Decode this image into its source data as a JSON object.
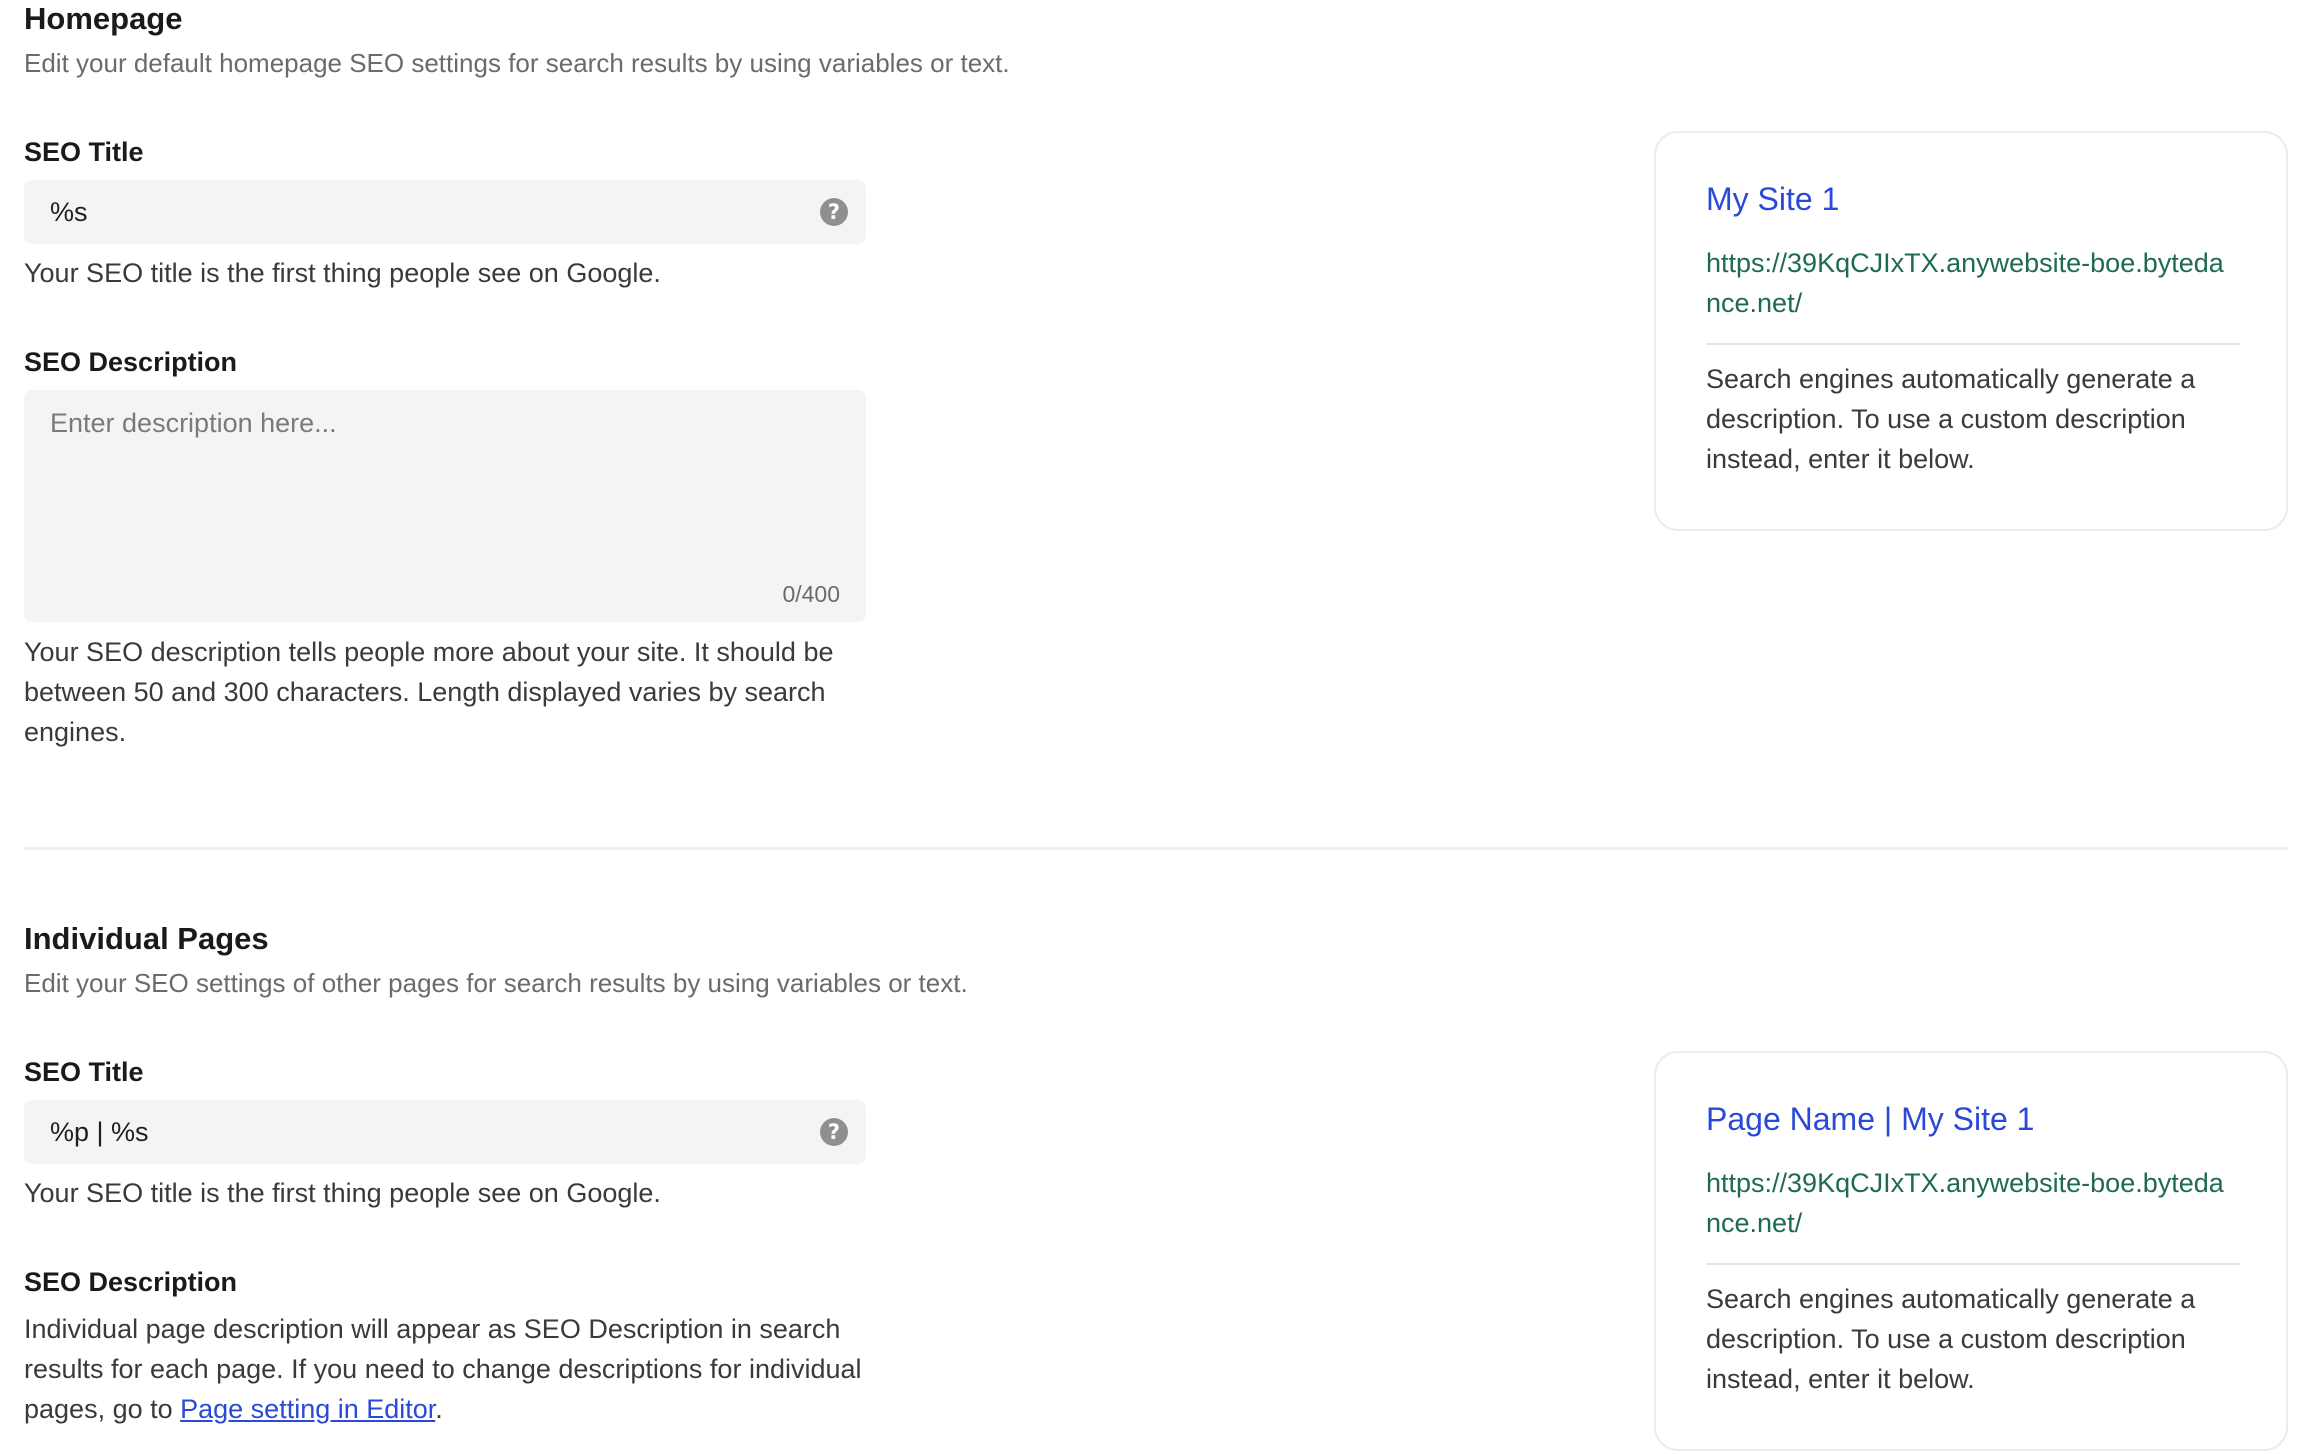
{
  "homepage": {
    "title": "Homepage",
    "subtitle": "Edit your default homepage SEO settings for search results by using variables or text.",
    "seo_title": {
      "label": "SEO Title",
      "value": "%s",
      "help_icon": "?",
      "hint": "Your SEO title is the first thing people see on Google."
    },
    "seo_description": {
      "label": "SEO Description",
      "placeholder": "Enter description here...",
      "counter": "0/400",
      "hint": "Your SEO description tells people more about your site. It should be between 50 and 300 characters. Length displayed varies by search engines."
    },
    "preview": {
      "title": "My Site 1",
      "url": "https://39KqCJIxTX.anywebsite-boe.bytedance.net/",
      "description": "Search engines automatically generate a description. To use a custom description instead, enter it below."
    }
  },
  "individual_pages": {
    "title": "Individual Pages",
    "subtitle": "Edit your SEO settings of other pages for search results by using variables or text.",
    "seo_title": {
      "label": "SEO Title",
      "value": "%p | %s",
      "help_icon": "?",
      "hint": "Your SEO title is the first thing people see on Google."
    },
    "seo_description": {
      "label": "SEO Description",
      "text_before_link": "Individual page description will appear as SEO Description in search results for each page. If you need to change descriptions for individual pages, go to ",
      "link": "Page setting in Editor",
      "text_after_link": "."
    },
    "preview": {
      "title": "Page Name | My Site 1",
      "url": "https://39KqCJIxTX.anywebsite-boe.bytedance.net/",
      "description": "Search engines automatically generate a description. To use a custom description instead, enter it below."
    }
  },
  "colors": {
    "link_blue": "#2a49d9",
    "url_green": "#1f6b4e",
    "field_bg": "#f4f4f4"
  },
  "icons": {
    "help": "question-circle-icon"
  }
}
